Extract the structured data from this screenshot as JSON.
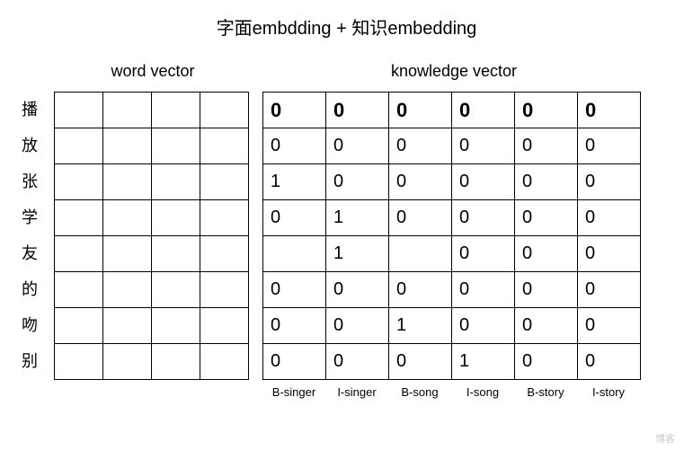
{
  "title": "字面embdding + 知识embedding",
  "section": {
    "word": "word vector",
    "knowledge": "knowledge vector"
  },
  "rows": [
    "播",
    "放",
    "张",
    "学",
    "友",
    "的",
    "吻",
    "别"
  ],
  "cols": [
    "B-singer",
    "I-singer",
    "B-song",
    "I-song",
    "B-story",
    "I-story"
  ],
  "chart_data": {
    "type": "table",
    "title": "knowledge vector",
    "row_labels": [
      "播",
      "放",
      "张",
      "学",
      "友",
      "的",
      "吻",
      "别"
    ],
    "col_labels": [
      "B-singer",
      "I-singer",
      "B-song",
      "I-song",
      "B-story",
      "I-story"
    ],
    "values": [
      [
        "0",
        "0",
        "0",
        "0",
        "0",
        "0"
      ],
      [
        "0",
        "0",
        "0",
        "0",
        "0",
        "0"
      ],
      [
        "1",
        "0",
        "0",
        "0",
        "0",
        "0"
      ],
      [
        "0",
        "1",
        "0",
        "0",
        "0",
        "0"
      ],
      [
        "",
        "1",
        "",
        "0",
        "0",
        "0"
      ],
      [
        "0",
        "0",
        "0",
        "0",
        "0",
        "0"
      ],
      [
        "0",
        "0",
        "1",
        "0",
        "0",
        "0"
      ],
      [
        "0",
        "0",
        "0",
        "1",
        "0",
        "0"
      ]
    ]
  },
  "watermark": "博客"
}
